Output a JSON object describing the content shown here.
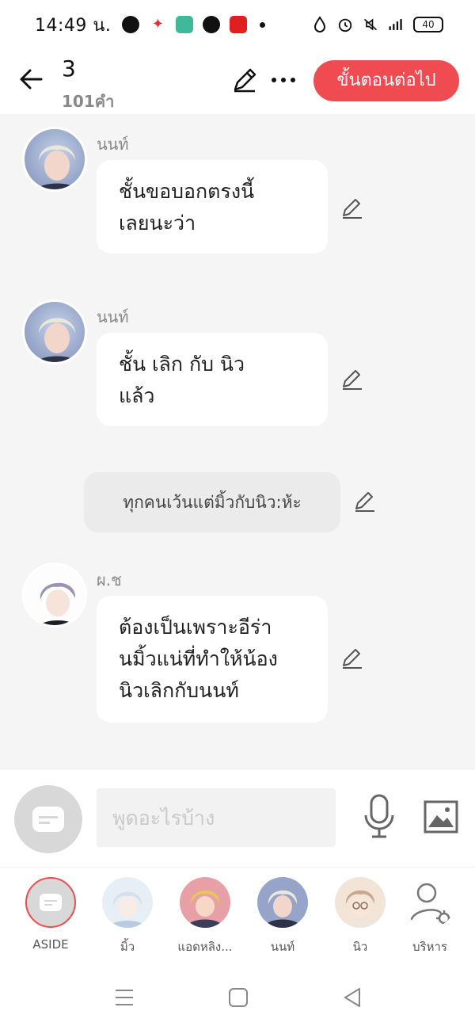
{
  "status_bar": {
    "time": "14:49 น.",
    "app_icons": [
      "facebook-icon",
      "app-icon",
      "calculator-icon",
      "pinterest-icon",
      "app-c-icon"
    ],
    "battery": "40"
  },
  "header": {
    "title": "3",
    "word_count": "101คำ",
    "next_label": "ขั้นตอนต่อไป"
  },
  "messages": [
    {
      "speaker": "นนท์",
      "text_lines": [
        "ชั้นขอบอกตรงนี้",
        "เลยนะว่า"
      ]
    },
    {
      "speaker": "นนท์",
      "text_lines": [
        "ชั้น เลิก กับ นิว",
        "แล้ว"
      ]
    },
    {
      "aside": "ทุกคนเว้นแต่มิ้วกับนิว:ห้ะ"
    },
    {
      "speaker": "ผ.ช",
      "text_lines": [
        "ต้องเป็นเพราะอีร่า",
        "นมิ้วแน่ที่ทำให้น้อง",
        "นิวเลิกกับนนท์"
      ]
    }
  ],
  "input": {
    "placeholder": "พูดอะไรบ้าง"
  },
  "characters": [
    {
      "label": "ASIDE"
    },
    {
      "label": "มิ้ว"
    },
    {
      "label": "แอดหลิง..."
    },
    {
      "label": "นนท์"
    },
    {
      "label": "นิว"
    },
    {
      "label": "บริหาร"
    }
  ],
  "colors": {
    "accent": "#f04b51",
    "background": "#f5f5f5",
    "bubble": "#ffffff",
    "aside_bubble": "#ebebeb"
  }
}
